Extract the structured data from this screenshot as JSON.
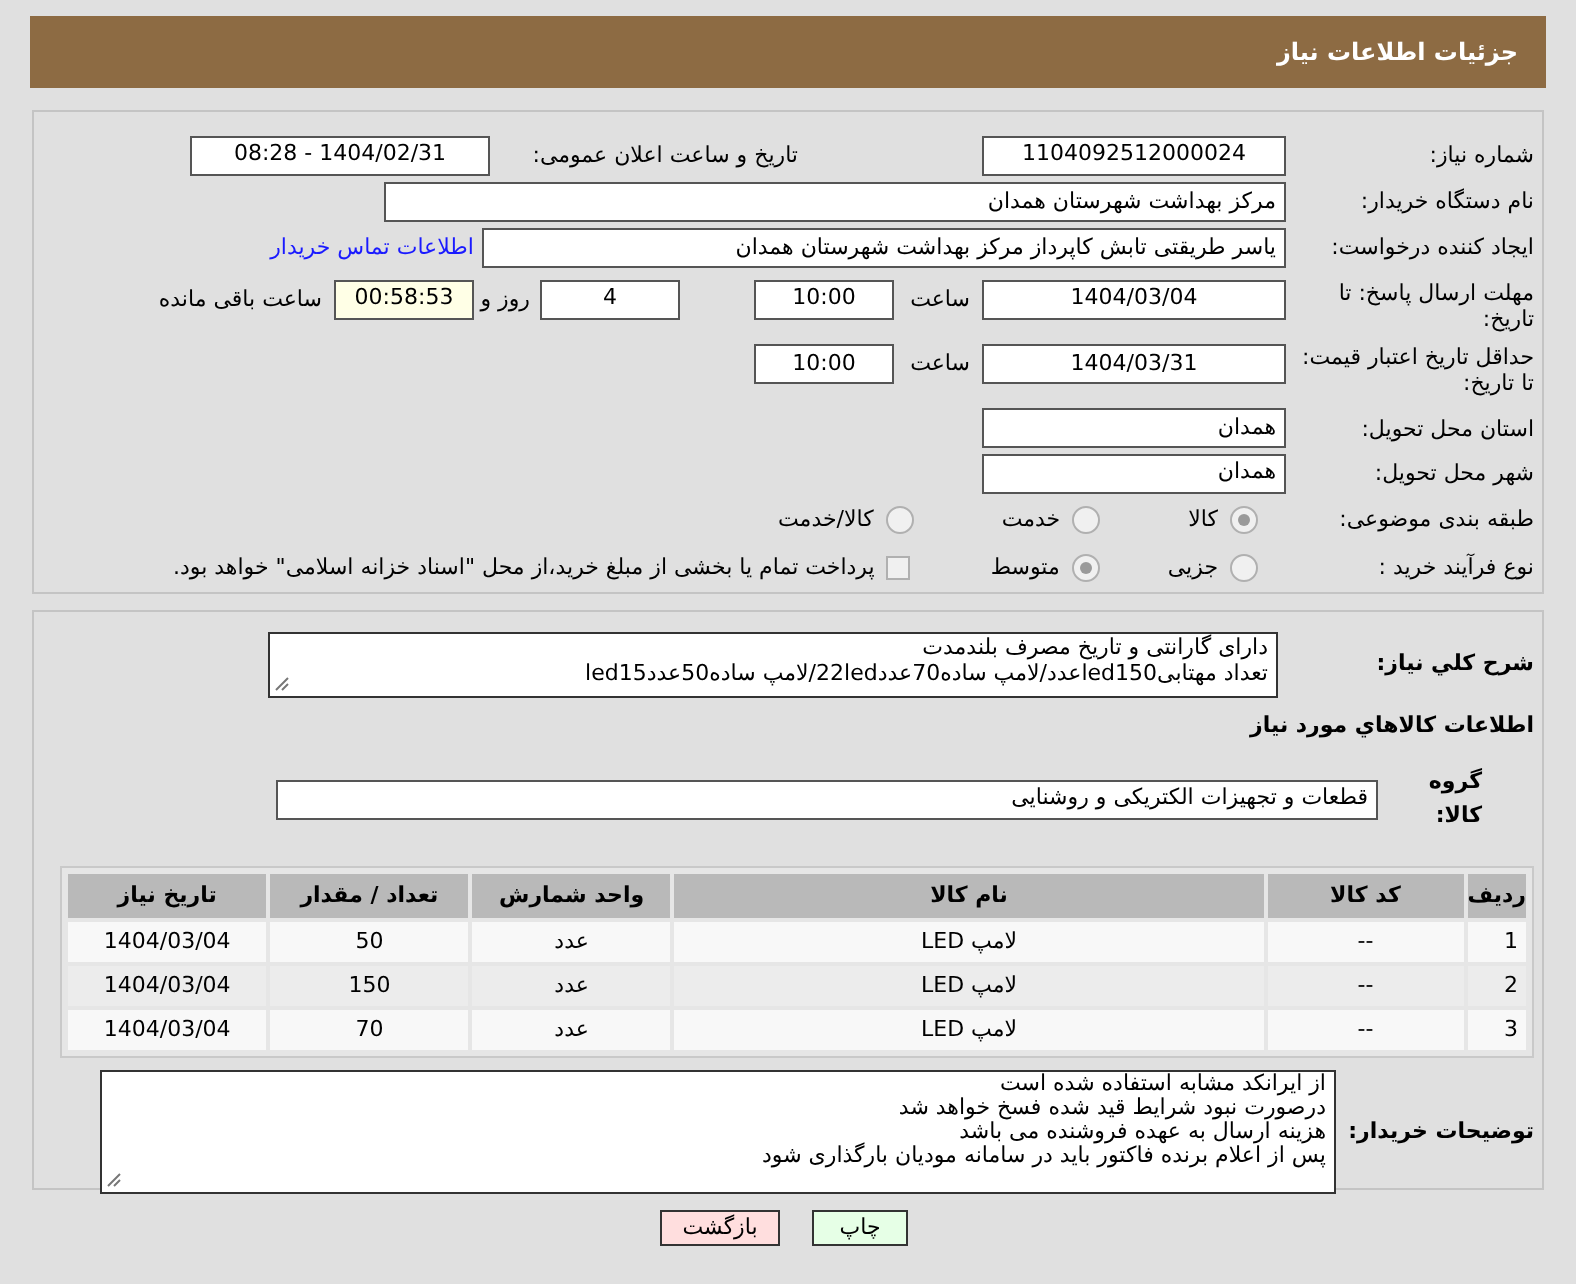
{
  "header": {
    "title": "جزئیات اطلاعات نیاز"
  },
  "need_number": {
    "label": "شماره نیاز:",
    "value": "1104092512000024"
  },
  "announce_datetime": {
    "label": "تاریخ و ساعت اعلان عمومی:",
    "value": "1404/02/31 - 08:28"
  },
  "buyer_org": {
    "label": "نام دستگاه خریدار:",
    "value": "مرکز بهداشت شهرستان همدان"
  },
  "requester": {
    "label": "ایجاد کننده درخواست:",
    "value": "یاسر طریقتی تابش کاپرداز مرکز بهداشت شهرستان همدان",
    "contact_link": "اطلاعات تماس خریدار"
  },
  "response_deadline": {
    "label": "مهلت ارسال پاسخ: تا تاریخ:",
    "date": "1404/03/04",
    "time_label": "ساعت",
    "time": "10:00",
    "days": "4",
    "days_label": "روز و",
    "remaining": "00:58:53",
    "remaining_label": "ساعت باقی مانده"
  },
  "price_validity": {
    "label": "حداقل تاریخ اعتبار قیمت: تا تاریخ:",
    "date": "1404/03/31",
    "time_label": "ساعت",
    "time": "10:00"
  },
  "delivery_province": {
    "label": "استان محل تحویل:",
    "value": "همدان"
  },
  "delivery_city": {
    "label": "شهر محل تحویل:",
    "value": "همدان"
  },
  "category": {
    "label": "طبقه بندی موضوعی:",
    "options": [
      {
        "label": "کالا",
        "selected": true
      },
      {
        "label": "خدمت",
        "selected": false
      },
      {
        "label": "کالا/خدمت",
        "selected": false
      }
    ]
  },
  "purchase_process": {
    "label": "نوع فرآیند خرید :",
    "options": [
      {
        "label": "جزیی",
        "selected": false
      },
      {
        "label": "متوسط",
        "selected": true
      }
    ],
    "treasury_checkbox": {
      "label": "پرداخت تمام یا بخشی از مبلغ خرید،از محل \"اسناد خزانه اسلامی\" خواهد بود.",
      "checked": false
    }
  },
  "description": {
    "label": "شرح کلي نياز:",
    "text": "دارای گارانتی و تاریخ مصرف بلندمدت\nتعداد مهتابیled150عدد/لامپ ساده70عدد22led/لامپ ساده50عددled15"
  },
  "goods_heading": "اطلاعات کالاهاي مورد نياز",
  "goods_group": {
    "label": "گروه کالا:",
    "value": "قطعات و تجهیزات الکتریکی و روشنایی"
  },
  "table": {
    "columns": [
      "ردیف",
      "کد کالا",
      "نام کالا",
      "واحد شمارش",
      "تعداد / مقدار",
      "تاریخ نیاز"
    ],
    "rows": [
      [
        "1",
        "--",
        "لامپ LED",
        "عدد",
        "50",
        "1404/03/04"
      ],
      [
        "2",
        "--",
        "لامپ LED",
        "عدد",
        "150",
        "1404/03/04"
      ],
      [
        "3",
        "--",
        "لامپ LED",
        "عدد",
        "70",
        "1404/03/04"
      ]
    ]
  },
  "buyer_notes": {
    "label": "توضیحات خریدار:",
    "text": "از ایرانکد مشابه استفاده شده است\nدرصورت نبود شرایط قید شده  فسخ خواهد شد\nهزینه ارسال  به عهده فروشنده می باشد\nپس از اعلام برنده فاکتور باید در سامانه مودیان بارگذاری شود"
  },
  "buttons": [
    {
      "label": "چاپ",
      "kind": "print"
    },
    {
      "label": "بازگشت",
      "kind": "back"
    }
  ]
}
